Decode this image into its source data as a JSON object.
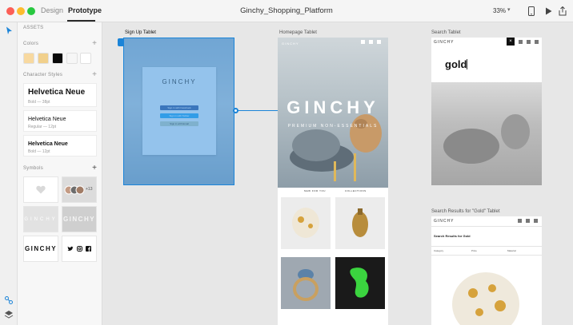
{
  "titlebar": {
    "modes": [
      "Design",
      "Prototype"
    ],
    "document_title": "Ginchy_Shopping_Platform",
    "zoom": "33%",
    "icons": [
      "device-preview-icon",
      "play-icon",
      "share-icon"
    ]
  },
  "assets": {
    "panel_title": "ASSETS",
    "colors_title": "Colors",
    "swatches": [
      "#f8d9a0",
      "#f1d08c",
      "#0a0a0a",
      "#f6f6f6",
      "#ffffff"
    ],
    "character_styles_title": "Character Styles",
    "character_styles": [
      {
        "name": "Helvetica Neue",
        "meta": "Bold — 38pt"
      },
      {
        "name": "Helvetica Neue",
        "meta": "Regular — 12pt"
      },
      {
        "name": "Helvetica Neue",
        "meta": "Bold — 12pt"
      }
    ],
    "symbols_title": "Symbols",
    "symbols": [
      {
        "kind": "heart-icon"
      },
      {
        "kind": "avatars",
        "badge": "+13"
      },
      {
        "kind": "logo-light",
        "text": "GINCHY"
      },
      {
        "kind": "logo-outline",
        "text": "GINCHY"
      },
      {
        "kind": "logo-dark",
        "text": "GINCHY"
      },
      {
        "kind": "social-icons"
      }
    ]
  },
  "canvas": {
    "signup": {
      "label": "Sign Up Tablet",
      "logo": "GINCHY",
      "buttons": [
        {
          "label": "Sign in with Facebook",
          "color": "#3b5c9a"
        },
        {
          "label": "Sign in with Twitter",
          "color": "#2aa3e8"
        },
        {
          "label": "Sign in with Email",
          "color": "#b7c7b8"
        }
      ]
    },
    "homepage": {
      "label": "Homepage Tablet",
      "brand": "GINCHY",
      "hero_title": "GINCHY",
      "hero_subtitle": "PREMIUM NON-ESSENTIALS",
      "nav": [
        "NEW FOR YOU",
        "COLLECTIONS"
      ]
    },
    "search": {
      "label": "Search Tablet",
      "brand": "GINCHY",
      "query": "gold"
    },
    "results": {
      "label": "Search Results for \"Gold\" Tablet",
      "brand": "GINCHY",
      "title": "Search Results for Gold",
      "filters": [
        "Category",
        "Price",
        "Material"
      ]
    }
  },
  "accent": "#1b84d8"
}
